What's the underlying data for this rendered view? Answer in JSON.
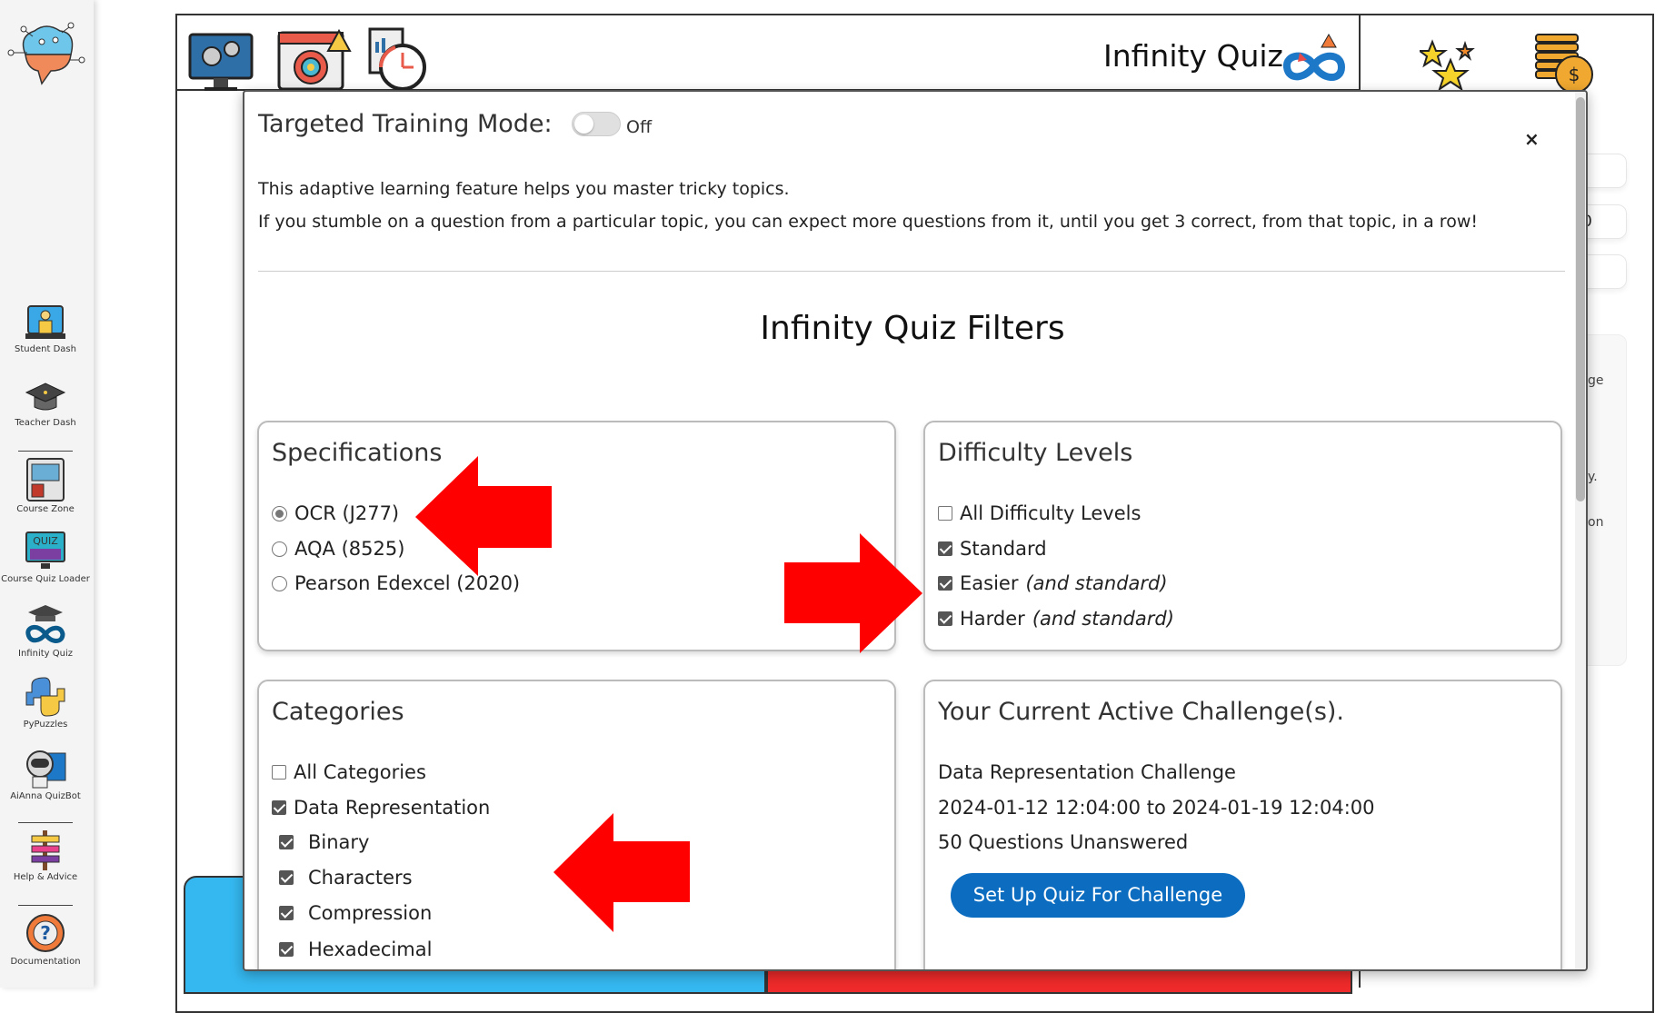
{
  "sidebar": {
    "items": [
      {
        "label": "Student Dash",
        "icon": "student-dash-icon"
      },
      {
        "label": "Teacher Dash",
        "icon": "graduation-cap-icon"
      },
      {
        "label": "Course Zone",
        "icon": "course-zone-icon"
      },
      {
        "label": "Course Quiz Loader",
        "icon": "quiz-monitor-icon"
      },
      {
        "label": "Infinity Quiz",
        "icon": "infinity-cap-icon"
      },
      {
        "label": "PyPuzzles",
        "icon": "python-icon"
      },
      {
        "label": "AiAnna QuizBot",
        "icon": "robot-icon"
      },
      {
        "label": "Help & Advice",
        "icon": "signpost-icon"
      },
      {
        "label": "Documentation",
        "icon": "lifebuoy-question-icon"
      }
    ]
  },
  "header": {
    "title": "Infinity Quiz",
    "toolbar_icons": [
      "settings-monitor-icon",
      "target-calendar-icon",
      "report-timer-icon"
    ],
    "right_icons": [
      "stars-icon",
      "coins-icon"
    ]
  },
  "background": {
    "panel_fragments": [
      "ge",
      "y.",
      "on"
    ],
    "pill_fragment": "0"
  },
  "modal": {
    "mode_label": "Targeted Training Mode:",
    "toggle_state": "Off",
    "toggle_on": false,
    "close_label": "×",
    "description": [
      "This adaptive learning feature helps you master tricky topics.",
      "If you stumble on a question from a particular topic, you can expect more questions from it, until you get 3 correct, from that topic, in a row!"
    ],
    "filters_title": "Infinity Quiz Filters",
    "specifications": {
      "title": "Specifications",
      "options": [
        {
          "label": "OCR (J277)",
          "selected": true
        },
        {
          "label": "AQA (8525)",
          "selected": false
        },
        {
          "label": "Pearson Edexcel (2020)",
          "selected": false
        }
      ]
    },
    "difficulty": {
      "title": "Difficulty Levels",
      "options": [
        {
          "label": "All Difficulty Levels",
          "note": "",
          "checked": false
        },
        {
          "label": "Standard",
          "note": "",
          "checked": true
        },
        {
          "label": "Easier",
          "note": "(and standard)",
          "checked": true
        },
        {
          "label": "Harder",
          "note": "(and standard)",
          "checked": true
        }
      ]
    },
    "categories": {
      "title": "Categories",
      "options": [
        {
          "label": "All Categories",
          "checked": false,
          "sub": false
        },
        {
          "label": "Data Representation",
          "checked": true,
          "sub": false
        },
        {
          "label": "Binary",
          "checked": true,
          "sub": true
        },
        {
          "label": "Characters",
          "checked": true,
          "sub": true
        },
        {
          "label": "Compression",
          "checked": true,
          "sub": true
        },
        {
          "label": "Hexadecimal",
          "checked": true,
          "sub": true
        }
      ]
    },
    "challenge": {
      "title": "Your Current Active Challenge(s).",
      "name": "Data Representation Challenge",
      "period": "2024-01-12 12:04:00 to 2024-01-19 12:04:00",
      "unanswered": "50 Questions Unanswered",
      "button": "Set Up Quiz For Challenge"
    }
  },
  "colors": {
    "annotation_arrow": "#ff0000",
    "button": "#0b6cc0",
    "blue_tile": "#35b8f0",
    "red_tile": "#ee2a2a"
  }
}
